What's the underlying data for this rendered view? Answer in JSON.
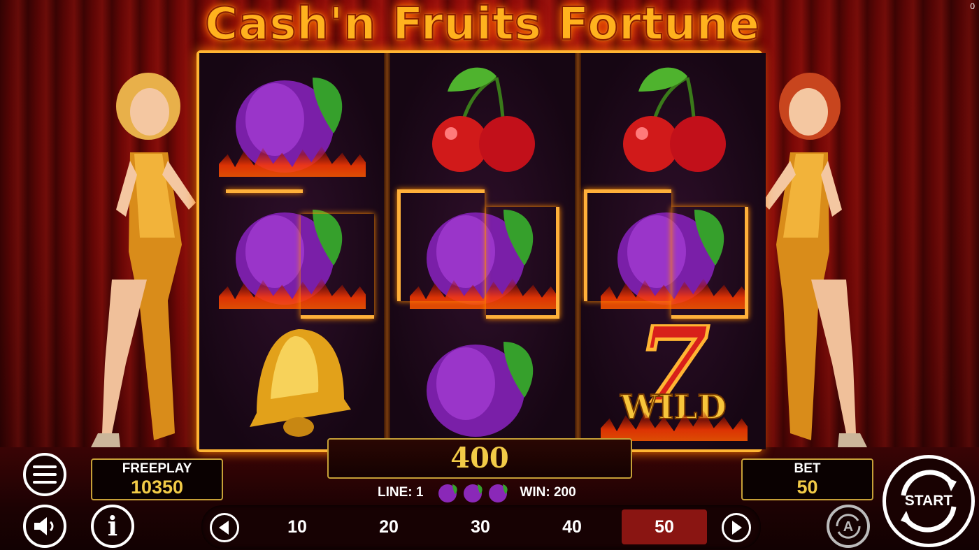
{
  "game": {
    "title": "Cash'n Fruits Fortune",
    "top_counter": "0"
  },
  "reels": [
    [
      "plum",
      "plum",
      "bell"
    ],
    [
      "cherry",
      "plum",
      "plum"
    ],
    [
      "cherry",
      "plum",
      "wild-seven"
    ]
  ],
  "wild_label": "WILD",
  "wild_digit": "7",
  "win_display": "400",
  "line_info": {
    "line_label": "LINE: 1",
    "win_label": "WIN: 200",
    "symbols": [
      "plum",
      "plum",
      "plum"
    ]
  },
  "freeplay": {
    "label": "FREEPLAY",
    "value": "10350"
  },
  "bet": {
    "label": "BET",
    "value": "50"
  },
  "bet_options": [
    "10",
    "20",
    "30",
    "40",
    "50"
  ],
  "selected_bet": "50",
  "buttons": {
    "start": "START",
    "autoplay": "A",
    "info": "i"
  },
  "colors": {
    "gold": "#f2cb47",
    "frame": "#ffb533",
    "selected_bet_bg": "#8a1512",
    "curtain": "#b81410"
  },
  "icons": {
    "menu": "menu-icon",
    "sound": "speaker-icon",
    "info": "info-icon",
    "prev": "arrow-left-icon",
    "next": "arrow-right-icon",
    "autoplay": "autoplay-icon",
    "start": "spin-arrows-icon"
  }
}
